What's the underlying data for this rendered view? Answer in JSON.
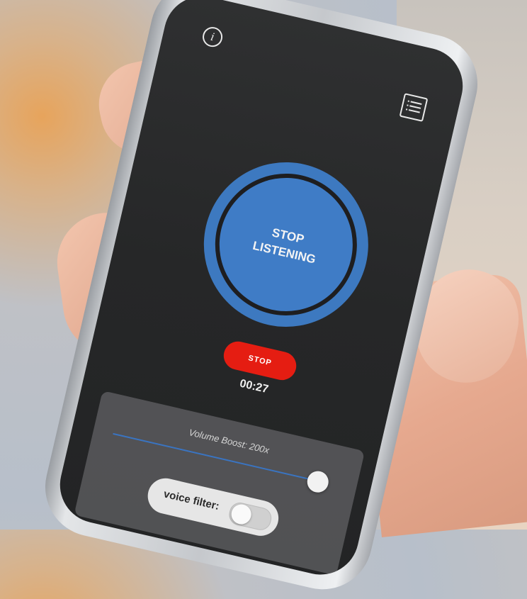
{
  "app": {
    "listen_button_label": "STOP\nLISTENING",
    "stop_button_label": "STOP",
    "timer": "00:27",
    "volume_boost_label": "Volume Boost: 200x",
    "voice_filter_label": "voice filter:",
    "voice_filter_enabled": false,
    "volume_level_fraction": 0.97
  },
  "colors": {
    "accent_blue": "#3f7cc6",
    "stop_red": "#e51d12",
    "screen_bg": "#262728"
  },
  "icons": {
    "info": "info-icon",
    "menu": "list-icon"
  }
}
